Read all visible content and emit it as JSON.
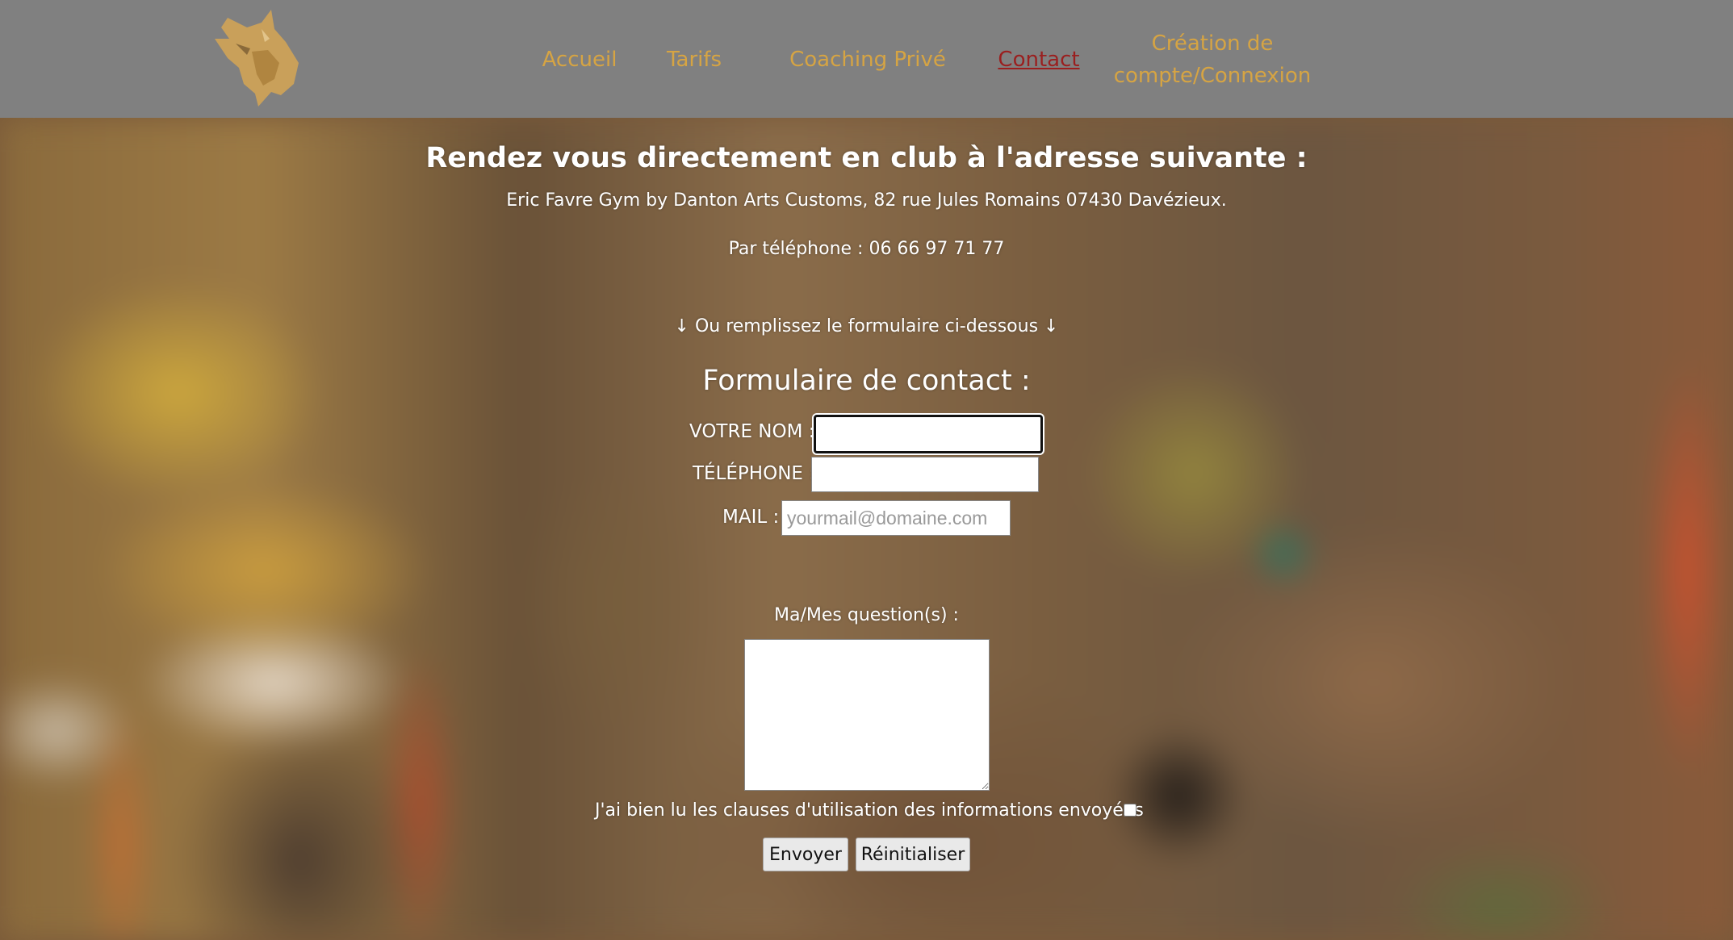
{
  "nav": {
    "items": [
      {
        "label": "Accueil"
      },
      {
        "label": "Tarifs"
      },
      {
        "label": "Coaching Privé"
      },
      {
        "label": "Contact"
      },
      {
        "label": "Création de compte/Connexion"
      }
    ],
    "active": "Contact",
    "link_color": "#d6a443",
    "active_color": "#9a1f1f"
  },
  "header": {
    "logo_icon": "lynx-head-icon",
    "background": "#808080"
  },
  "info": {
    "title": "Rendez vous directement en club à l'adresse suivante :",
    "address": "Eric Favre Gym by Danton Arts Customs, 82 rue Jules Romains 07430 Davézieux.",
    "phone_line": "Par téléphone : 06 66 97 71 77",
    "or_line": "↓ Ou remplissez le formulaire ci-dessous ↓"
  },
  "form": {
    "title": "Formulaire de contact :",
    "name_label": "VOTRE NOM :",
    "name_value": "",
    "phone_label": "TÉLÉPHONE :",
    "phone_value": "",
    "mail_label": "MAIL :",
    "mail_placeholder": "yourmail@domaine.com",
    "question_label": "Ma/Mes question(s) :",
    "question_value": "",
    "consent_label": "J'ai bien lu les clauses d'utilisation des informations envoyées",
    "consent_checked": false,
    "submit_label": "Envoyer",
    "reset_label": "Réinitialiser"
  }
}
